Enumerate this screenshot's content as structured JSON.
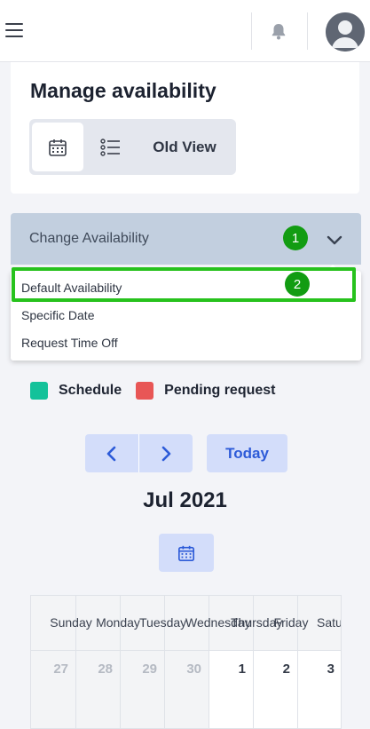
{
  "header": {
    "menu_icon": "hamburger-icon",
    "bell_icon": "bell-icon",
    "avatar_icon": "user-avatar-icon"
  },
  "page": {
    "title": "Manage availability",
    "view_toggle": {
      "calendar_icon": "calendar-icon",
      "list_icon": "list-icon",
      "old_view_label": "Old View"
    }
  },
  "change_availability": {
    "label": "Change Availability",
    "chevron_icon": "chevron-down-icon",
    "badge_1": "1",
    "badge_2": "2",
    "options": [
      "Default Availability",
      "Specific Date",
      "Request Time Off"
    ]
  },
  "legend": {
    "schedule_label": "Schedule",
    "schedule_color": "#13c29a",
    "pending_label": "Pending request",
    "pending_color": "#e85656"
  },
  "calendar_nav": {
    "prev_icon": "chevron-left-icon",
    "next_icon": "chevron-right-icon",
    "today_label": "Today",
    "month_label": "Jul 2021",
    "picker_icon": "calendar-icon"
  },
  "calendar": {
    "day_names": [
      "Sunday",
      "Monday",
      "Tuesday",
      "Wednesday",
      "Thursday",
      "Friday",
      "Saturday"
    ],
    "first_week": [
      "27",
      "28",
      "29",
      "30",
      "1",
      "2",
      "3"
    ]
  },
  "colors": {
    "accent": "#2d5bd8",
    "highlight": "#27c21d",
    "badge": "#129c12"
  }
}
